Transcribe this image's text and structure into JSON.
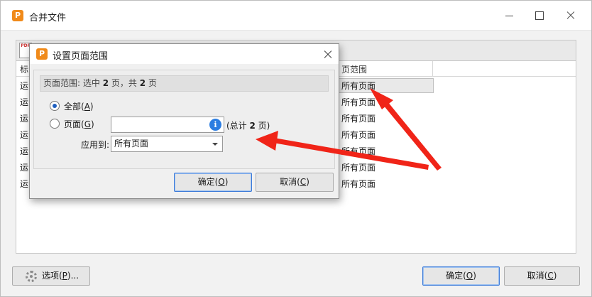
{
  "window": {
    "icon_letter": "P",
    "title": "合并文件"
  },
  "list": {
    "columns": [
      "标",
      "页范围"
    ],
    "rows": [
      {
        "name": "运",
        "range": "所有页面"
      },
      {
        "name": "运",
        "range": "所有页面"
      },
      {
        "name": "运",
        "range": "所有页面"
      },
      {
        "name": "运",
        "range": "所有页面"
      },
      {
        "name": "运",
        "range": "所有页面"
      },
      {
        "name": "运",
        "range": "所有页面"
      },
      {
        "name": "运",
        "range": "所有页面"
      }
    ]
  },
  "footer": {
    "options": "选项(",
    "options_key": "P",
    "options_tail": ")...",
    "ok": "确定(",
    "ok_key": "O",
    "ok_tail": ")",
    "cancel": "取消(",
    "cancel_key": "C",
    "cancel_tail": ")"
  },
  "dialog": {
    "icon_letter": "P",
    "title": "设置页面范围",
    "info_prefix": "页面范围: 选中 ",
    "info_selected": "2",
    "info_mid": " 页，共 ",
    "info_total": "2",
    "info_suffix": " 页",
    "radio_all": "全部(",
    "radio_all_key": "A",
    "radio_all_tail": ")",
    "radio_pages": "页面(",
    "radio_pages_key": "G",
    "radio_pages_tail": ")",
    "page_input_value": "",
    "info_icon": "i",
    "total_prefix": "(总计 ",
    "total_count": "2",
    "total_suffix": " 页)",
    "apply_to_label": "应用到:",
    "apply_to_value": "所有页面",
    "ok": "确定(",
    "ok_key": "O",
    "ok_tail": ")",
    "cancel": "取消(",
    "cancel_key": "C",
    "cancel_tail": ")"
  },
  "colors": {
    "accent_orange": "#f08a1a",
    "annotation_red": "#f02418",
    "selected_radio": "#1f5fbf",
    "info_blue": "#2b7de1"
  }
}
